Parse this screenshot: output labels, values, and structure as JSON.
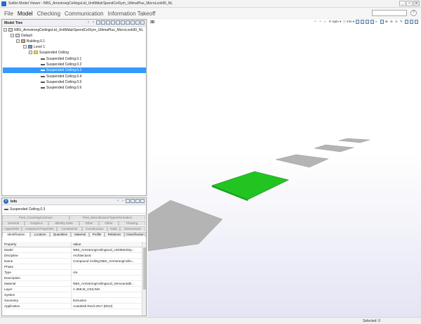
{
  "window": {
    "title": "Solibri Model Viewer - NBS_ArmstrongCeilingsLtd_UnitMdulrSpendCelSym_UltimaPlus_MicroLook90_NL",
    "controls": [
      "_",
      "□",
      "✕"
    ]
  },
  "menu": {
    "items": [
      "File",
      "Model",
      "Checking",
      "Communication",
      "Information Takeoff"
    ],
    "active": "Model",
    "help_icon": "?"
  },
  "model_tree": {
    "title": "Model Tree",
    "nodes": [
      {
        "label": "NBS_ArmstrongCeilingsLtd_UnitMdulrSpendCelSym_UltimaPlus_MicroLook90_NL",
        "expander": "−",
        "icon": "document-icon"
      },
      {
        "label": "Default",
        "expander": "−",
        "icon": "project-icon"
      },
      {
        "label": "Building.0.1",
        "expander": "−",
        "icon": "building-icon"
      },
      {
        "label": "Level 1",
        "expander": "−",
        "icon": "storey-icon"
      },
      {
        "label": "Suspended Ceiling",
        "expander": "−",
        "icon": "folder-icon"
      },
      {
        "label": "Suspended Ceiling.0.1",
        "icon": "ceiling-icon"
      },
      {
        "label": "Suspended Ceiling.0.2",
        "icon": "ceiling-icon"
      },
      {
        "label": "Suspended Ceiling.0.3",
        "icon": "ceiling-icon",
        "selected": true
      },
      {
        "label": "Suspended Ceiling.0.4",
        "icon": "ceiling-icon"
      },
      {
        "label": "Suspended Ceiling.0.5",
        "icon": "ceiling-icon"
      },
      {
        "label": "Suspended Ceiling.0.6",
        "icon": "ceiling-icon"
      }
    ]
  },
  "info": {
    "title": "Info",
    "selected_name": "Suspended Ceiling.0.3",
    "tab_rows": [
      [
        "Pset_CoveringCommon",
        "Pset_ManufacturerTypeInformation"
      ],
      [
        "General",
        "Graphics",
        "Identity Data",
        "Other",
        "Other",
        "Phasing"
      ],
      [
        "Hyperlinks",
        "Analytical Properties",
        "Constraints",
        "Construction",
        "Data",
        "Dimensions"
      ],
      [
        "Identification",
        "Location",
        "Quantities",
        "Material",
        "Profile",
        "Relations",
        "Classification"
      ]
    ],
    "active_tab": "Identification",
    "table_headers": [
      "Property",
      "Value"
    ],
    "properties": [
      {
        "name": "Model",
        "value": "NBS_ArmstrongCeilingsLtd_UnitMdulrSp..."
      },
      {
        "name": "Discipline",
        "value": "Architectural"
      },
      {
        "name": "Name",
        "value": "Compound Ceiling:NBS_ArmstrongCeilin..."
      },
      {
        "name": "Phase",
        "value": ""
      },
      {
        "name": "Type",
        "value": "n/a"
      },
      {
        "name": "Description",
        "value": ""
      },
      {
        "name": "Material",
        "value": "NBS_ArmstrongCeilingsLtd_Demountabl..."
      },
      {
        "name": "Layer",
        "value": "A-358-M_CEILING"
      },
      {
        "name": "System",
        "value": ""
      },
      {
        "name": "Geometry",
        "value": "Extrusion"
      },
      {
        "name": "Application",
        "value": "Autodesk Revit 2017 (ENU)"
      }
    ]
  },
  "view3d": {
    "label": "3D",
    "tools": [
      "Spin",
      "Info"
    ],
    "selection_color": "#22c422",
    "ceiling_color": "#b4b4b4"
  },
  "status": {
    "selected_text": "Selected: 0"
  },
  "colors": {
    "selection": "#3399ff",
    "accent": "#2e6ec3"
  }
}
